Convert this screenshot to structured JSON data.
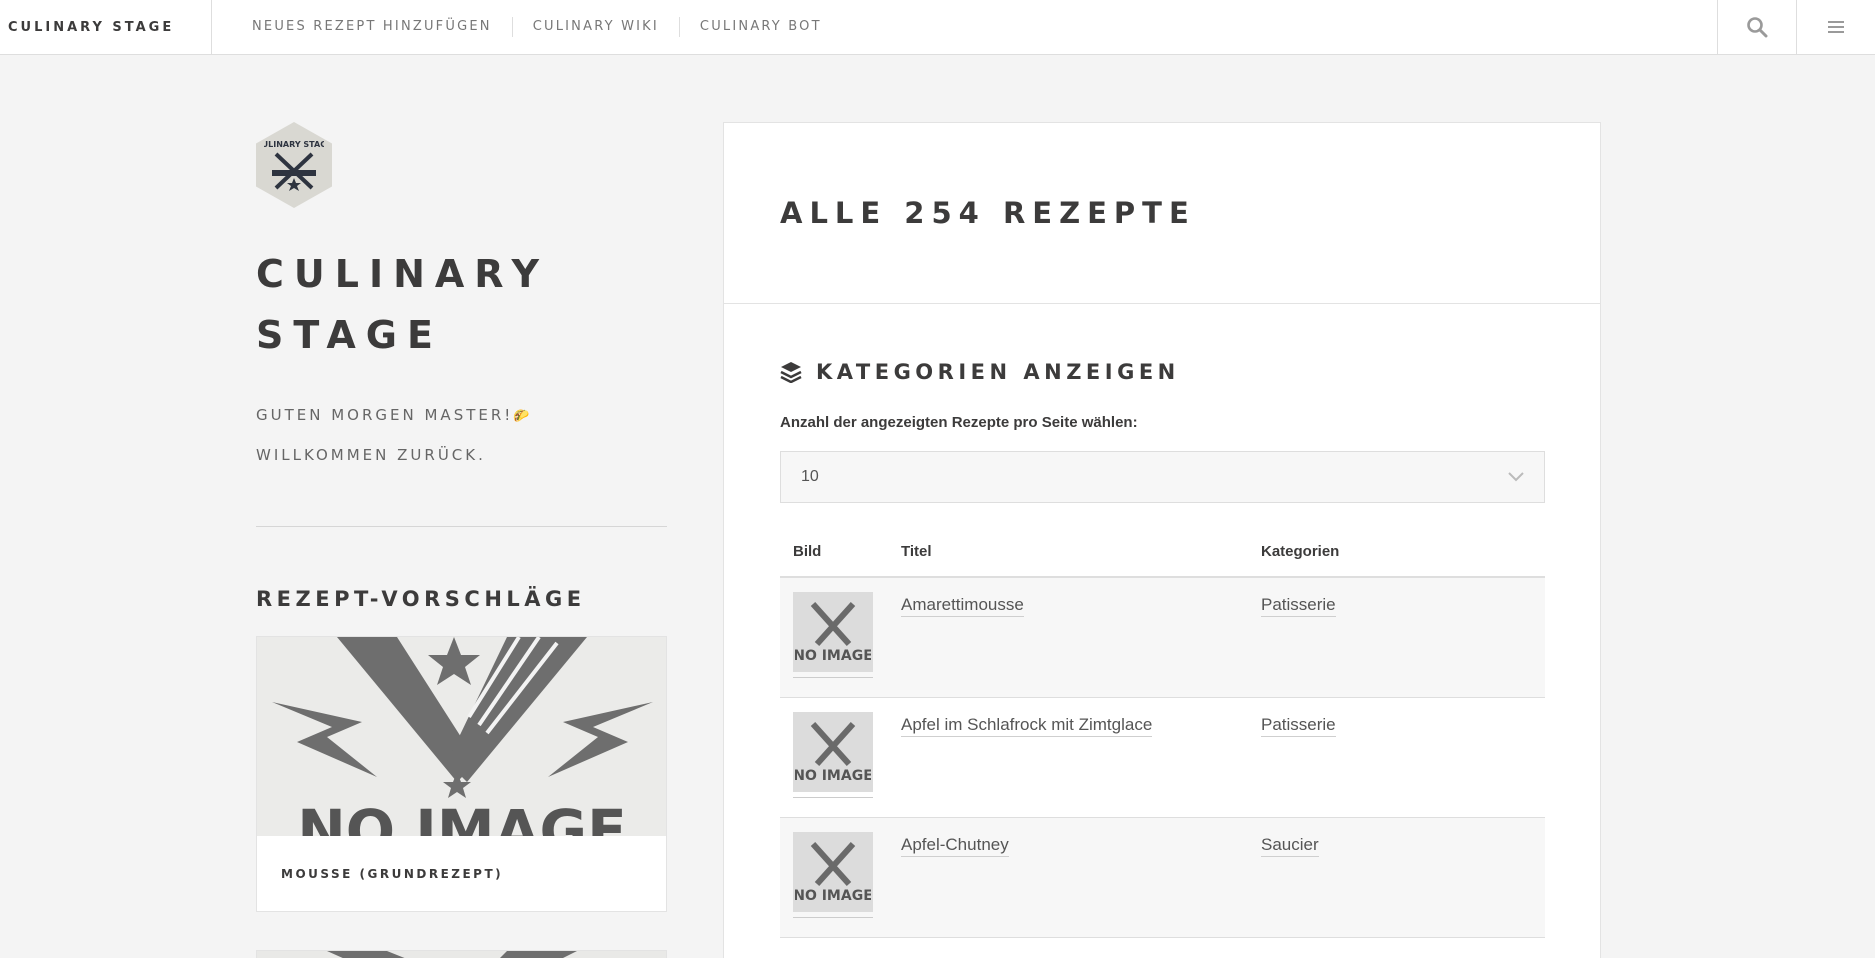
{
  "nav": {
    "brand": "CULINARY STAGE",
    "links": [
      "NEUES REZEPT HINZUFÜGEN",
      "CULINARY WIKI",
      "CULINARY BOT"
    ],
    "search_icon": "search-icon",
    "menu_icon": "hamburger-menu-icon"
  },
  "sidebar": {
    "logo_text": "CULINARY STAGE",
    "title_line1": "CULINARY",
    "title_line2": "STAGE",
    "greeting_line1": "GUTEN MORGEN MASTER!",
    "greeting_emoji": "🌮",
    "greeting_line2": "WILLKOMMEN ZURÜCK.",
    "suggestions_heading": "REZEPT-VORSCHLÄGE",
    "suggestion_image_text": "NO IMAGE",
    "suggestions": [
      {
        "title": "MOUSSE (GRUNDREZEPT)"
      }
    ]
  },
  "main": {
    "heading": "ALLE 254 REZEPTE",
    "categories_heading": "KATEGORIEN ANZEIGEN",
    "per_page_label": "Anzahl der angezeigten Rezepte pro Seite wählen:",
    "per_page_value": "10",
    "table": {
      "columns": [
        "Bild",
        "Titel",
        "Kategorien"
      ],
      "thumb_text": "NO IMAGE",
      "rows": [
        {
          "title": "Amarettimousse",
          "category": "Patisserie"
        },
        {
          "title": "Apfel im Schlafrock mit Zimtglace",
          "category": "Patisserie"
        },
        {
          "title": "Apfel-Chutney",
          "category": "Saucier"
        }
      ]
    }
  },
  "colors": {
    "background": "#f4f4f4",
    "text": "#3c3b3b",
    "panel": "#ffffff",
    "row_alt": "#f7f7f7"
  }
}
